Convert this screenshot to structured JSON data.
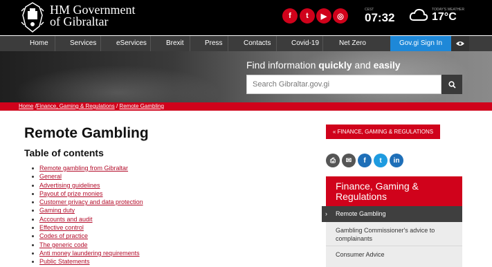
{
  "header": {
    "brand_line1": "HM Government",
    "brand_line2": "of Gibraltar",
    "social": [
      {
        "icon": "facebook-icon",
        "glyph": "f"
      },
      {
        "icon": "twitter-icon",
        "glyph": "t"
      },
      {
        "icon": "youtube-icon",
        "glyph": "▶"
      },
      {
        "icon": "instagram-icon",
        "glyph": "◎"
      }
    ],
    "time_label": "CEST",
    "time": "07:32",
    "weather_label": "TODAY'S WEATHER",
    "temperature": "17°C"
  },
  "nav": {
    "items": [
      "Home",
      "Services",
      "eServices",
      "Brexit",
      "Press",
      "Contacts",
      "Covid-19",
      "Net Zero"
    ],
    "signin_label": "Gov.gi Sign In"
  },
  "hero": {
    "find_prefix": "Find information ",
    "find_bold1": "quickly",
    "find_and": " and ",
    "find_bold2": "easily",
    "search_placeholder": "Search Gibraltar.gov.gi"
  },
  "breadcrumb": {
    "home": "Home",
    "sep1": " /",
    "section": "Finance, Gaming & Regulations",
    "sep2": " / ",
    "current": "Remote Gambling"
  },
  "main": {
    "title": "Remote Gambling",
    "toc_title": "Table of contents",
    "toc": [
      "Remote gambling from Gibraltar",
      "General",
      "Advertising guidelines",
      "Payout of prize monies",
      "Customer privacy and data protection",
      "Gaming duty",
      "Accounts and audit",
      "Effective control",
      "Codes of practice",
      "The generic code",
      "Anti money laundering requirements",
      "Public Statements"
    ]
  },
  "sidebar": {
    "back_label": "« FINANCE, GAMING & REGULATIONS",
    "share": [
      {
        "icon": "print-icon",
        "glyph": "⎙",
        "color": "#555555"
      },
      {
        "icon": "email-icon",
        "glyph": "✉",
        "color": "#555555"
      },
      {
        "icon": "facebook-icon",
        "glyph": "f",
        "color": "#1e6fb8"
      },
      {
        "icon": "twitter-icon",
        "glyph": "t",
        "color": "#1e9be0"
      },
      {
        "icon": "linkedin-icon",
        "glyph": "in",
        "color": "#1e6fb8"
      }
    ],
    "panel_title": "Finance, Gaming & Regulations",
    "active_item": "Remote Gambling",
    "items": [
      "Gambling Commissioner's advice to complainants",
      "Consumer Advice"
    ]
  },
  "colors": {
    "accent_red": "#d0021b",
    "nav_bg": "#3c3c3c",
    "signin_blue": "#1e88d8"
  }
}
